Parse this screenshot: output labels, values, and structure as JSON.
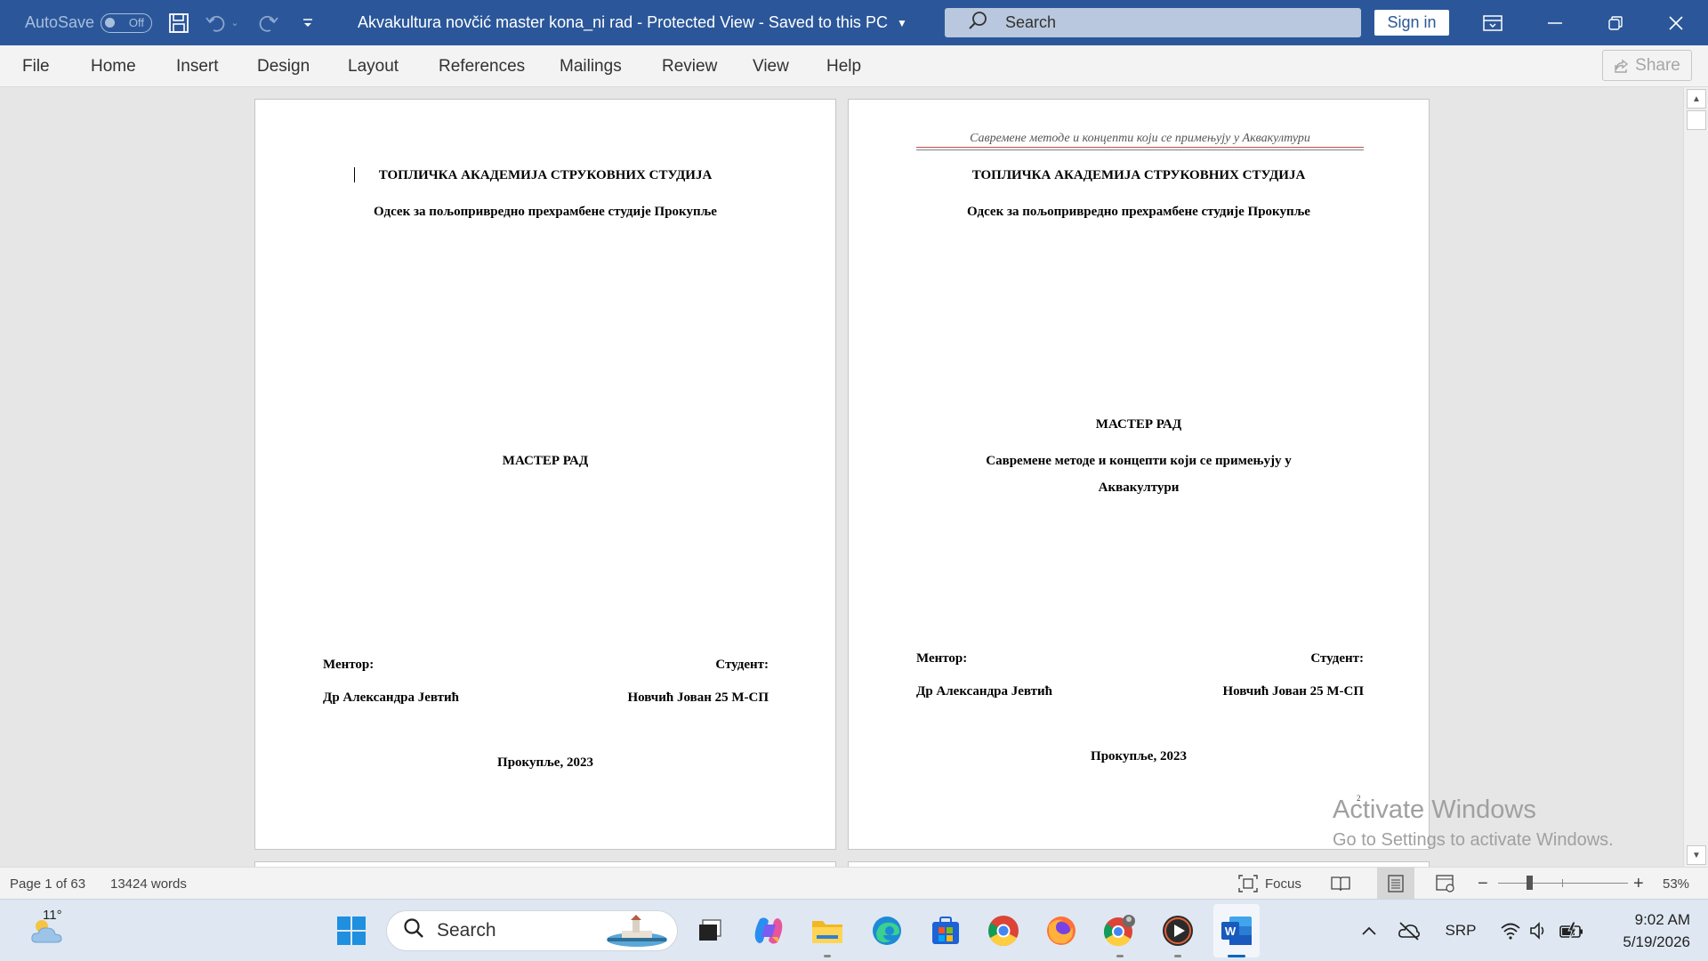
{
  "titlebar": {
    "autosave_label": "AutoSave",
    "autosave_state": "Off",
    "document_title": "Akvakultura novčić master kona_ni rad  -  Protected View  -  Saved to this PC",
    "search_placeholder": "Search",
    "signin_label": "Sign in"
  },
  "ribbon": {
    "tabs": [
      "File",
      "Home",
      "Insert",
      "Design",
      "Layout",
      "References",
      "Mailings",
      "Review",
      "View",
      "Help"
    ],
    "share_label": "Share"
  },
  "pages": [
    {
      "institution": "ТОПЛИЧКА АКАДЕМИЈА СТРУКОВНИХ СТУДИЈА",
      "department": "Одсек за пољопривредно прехрамбене студије Прокупље",
      "doc_type": "МАСТЕР РАД",
      "mentor_label": "Ментор:",
      "mentor_name": "Др Александра Јевтић",
      "student_label": "Студент:",
      "student_name": "Новчић Јован 25 М-СП",
      "place_year": "Прокупље, 2023"
    },
    {
      "header": "Савремене методе и концепти који се примењују у Аквакултури",
      "institution": "ТОПЛИЧКА АКАДЕМИЈА СТРУКОВНИХ СТУДИЈА",
      "department": "Одсек за пољопривредно прехрамбене студије Прокупље",
      "doc_type": "МАСТЕР РАД",
      "subtitle_line1": "Савремене методе и концепти који се примењују у",
      "subtitle_line2": "Аквакултури",
      "mentor_label": "Ментор:",
      "mentor_name": "Др Александра Јевтић",
      "student_label": "Студент:",
      "student_name": "Новчић  Јован 25 М-СП",
      "place_year": "Прокупље, 2023",
      "page_number": "2"
    }
  ],
  "watermark": {
    "line1": "Activate Windows",
    "line2": "Go to Settings to activate Windows."
  },
  "statusbar": {
    "page_info": "Page 1 of 63",
    "word_count": "13424 words",
    "focus_label": "Focus",
    "zoom_level": "53%"
  },
  "taskbar": {
    "weather_temp": "11°",
    "search_placeholder": "Search",
    "language": "SRP",
    "time": "9:02 AM",
    "date": "5/19/2026"
  },
  "colors": {
    "word_blue": "#2b579a",
    "header_rule": "#c0504d"
  }
}
